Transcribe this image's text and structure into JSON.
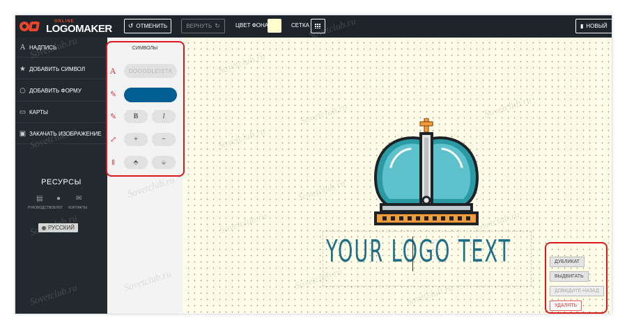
{
  "header": {
    "logo_online": "ONLINE",
    "logo_main": "LOGOMAKER",
    "undo_label": "ОТМЕНИТЬ",
    "redo_label": "ВЕРНУТЬ",
    "bg_color_label": "ЦВЕТ ФОНА",
    "bg_color": "#fffcd0",
    "grid_label": "СЕТКА",
    "new_label": "НОВЫЙ"
  },
  "sidebar": {
    "items": [
      {
        "icon": "A",
        "label": "НАДПИСЬ"
      },
      {
        "icon": "★",
        "label": "ДОБАВИТЬ СИМВОЛ"
      },
      {
        "icon": "○",
        "label": "ДОБАВИТЬ ФОРМУ"
      },
      {
        "icon": "▭",
        "label": "КАРТЫ"
      },
      {
        "icon": "▣",
        "label": "ЗАКАЧАТЬ ИЗОБРАЖЕНИЕ"
      }
    ],
    "resources_title": "РЕСУРСЫ",
    "resources": [
      "РУКОВОДСТВО",
      "БЛОГ",
      "КОНТАКТЫ"
    ],
    "language": "РУССКИЙ"
  },
  "symbol_panel": {
    "title": "СИМВОЛЫ",
    "font_name": "DOOODLEISTA",
    "color": "#005e93",
    "bold_label": "B",
    "italic_label": "I",
    "size_up_label": "+",
    "size_down_label": "−"
  },
  "canvas": {
    "logo_text": "YOUR LOGO TEXT",
    "text_color": "#1e6f88",
    "watermark": "Sovetclub.ru"
  },
  "context_menu": {
    "duplicate": "ДУБЛИКАТ",
    "bring_forward": "ВЫДВИГАТЬ",
    "send_back": "ДОВЕДИТЕ НАЗАД",
    "delete": "УДАЛЯТЬ"
  }
}
